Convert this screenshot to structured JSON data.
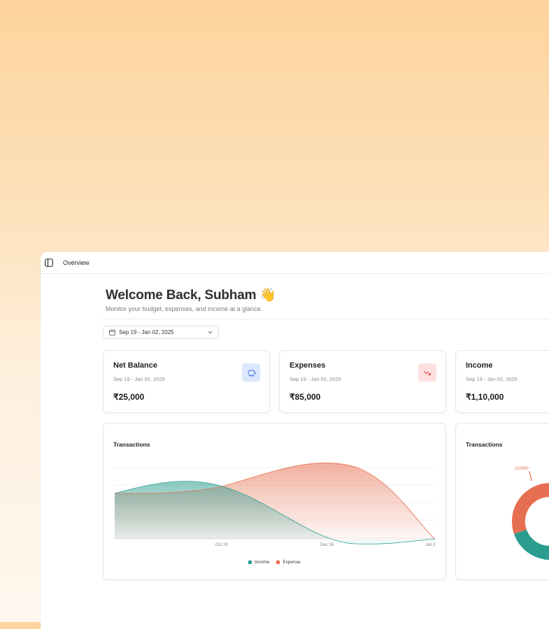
{
  "topbar": {
    "breadcrumb": "Overview",
    "toggle_icon": "sidebar-toggle-icon"
  },
  "header": {
    "title": "Welcome Back, Subham 👋",
    "subtitle": "Monitor your budget, expenses, and income at a glance."
  },
  "date_filter": {
    "value": "Sep 19 - Jan 02, 2025",
    "icon": "calendar-icon"
  },
  "cards": [
    {
      "name": "Net Balance",
      "range": "Sep 19 - Jan 02, 2025",
      "amount": "₹25,000",
      "icon": "piggy-bank-icon",
      "badge_bg": "#dbe8fd",
      "icon_color": "#3b6fd9"
    },
    {
      "name": "Expenses",
      "range": "Sep 19 - Jan 02, 2025",
      "amount": "₹85,000",
      "icon": "trending-down-icon",
      "badge_bg": "#fde0e0",
      "icon_color": "#e24a4a"
    },
    {
      "name": "Income",
      "range": "Sep 19 - Jan 02, 2025",
      "amount": "₹1,10,000",
      "icon": "trending-up-icon",
      "badge_bg": "#dcf5e7",
      "icon_color": "#2a9d8f"
    }
  ],
  "colors": {
    "income": "#2a9d8f",
    "expense": "#e76f51"
  },
  "chart_data": [
    {
      "type": "area",
      "title": "Transactions",
      "x_ticks": [
        "Oct 19",
        "Dec 16",
        "Jan 2"
      ],
      "series": [
        {
          "name": "Income",
          "color": "#2a9d8f"
        },
        {
          "name": "Expense",
          "color": "#e76f51"
        }
      ],
      "legend": "bottom-center"
    },
    {
      "type": "pie",
      "title": "Transactions",
      "slices": [
        {
          "label": "110000",
          "value": 110000,
          "color": "#e76f51"
        }
      ]
    }
  ]
}
